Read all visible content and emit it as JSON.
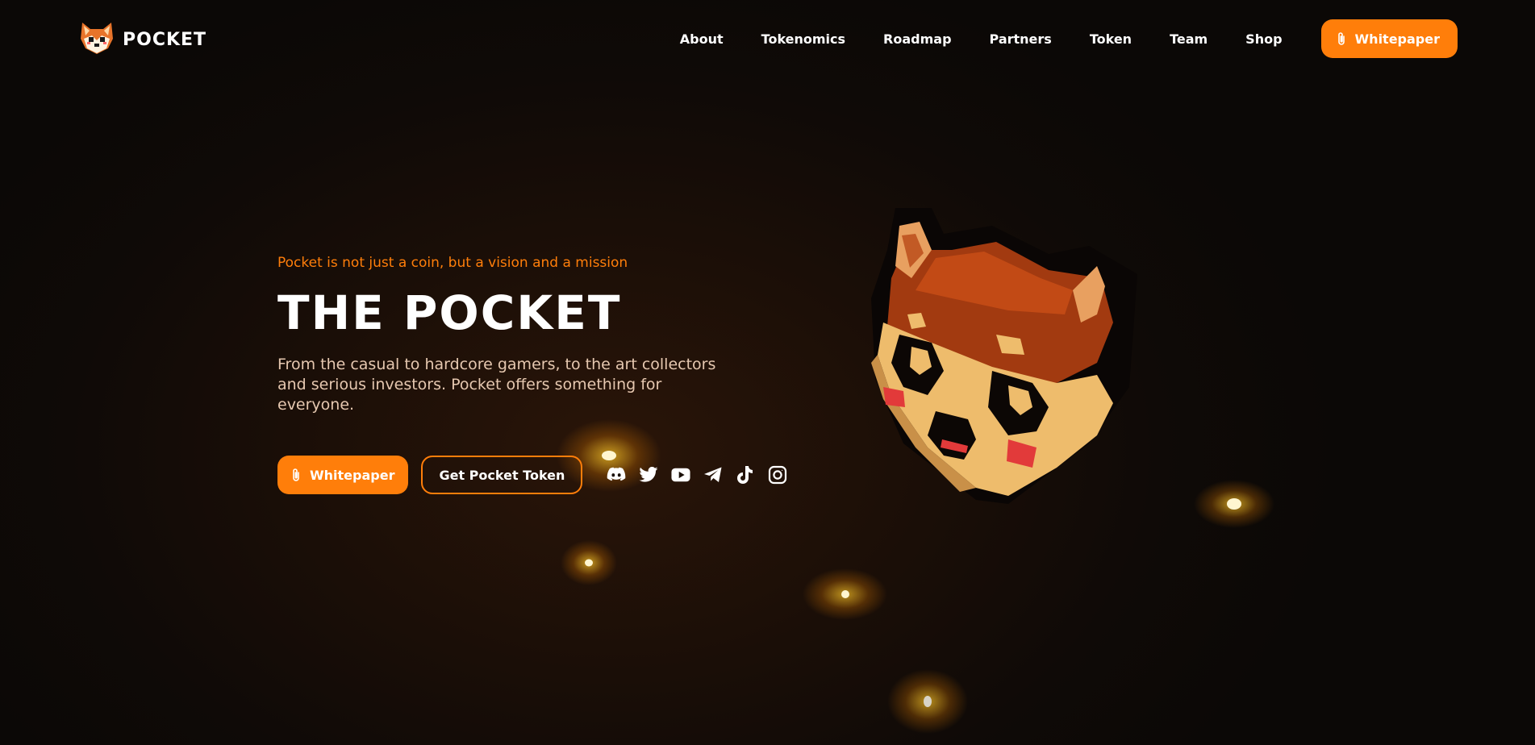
{
  "brand": {
    "name": "POCKET",
    "logo_icon": "fox-head-logo"
  },
  "nav": {
    "links": [
      "About",
      "Tokenomics",
      "Roadmap",
      "Partners",
      "Token",
      "Team",
      "Shop"
    ],
    "cta_label": "Whitepaper",
    "cta_icon": "paperclip-icon"
  },
  "hero": {
    "tagline": "Pocket is not just a coin, but a vision and a mission",
    "title": "THE POCKET",
    "description": "From the casual to hardcore gamers, to the art collectors and serious investors. Pocket offers something for everyone.",
    "primary_button": "Whitepaper",
    "secondary_button": "Get Pocket Token"
  },
  "socials": [
    "discord-icon",
    "twitter-icon",
    "youtube-icon",
    "telegram-icon",
    "tiktok-icon",
    "instagram-icon"
  ],
  "colors": {
    "accent": "#ff7e0a",
    "background": "#0d0906",
    "tagline": "#ff7e0a",
    "description": "#e6c8b0"
  }
}
